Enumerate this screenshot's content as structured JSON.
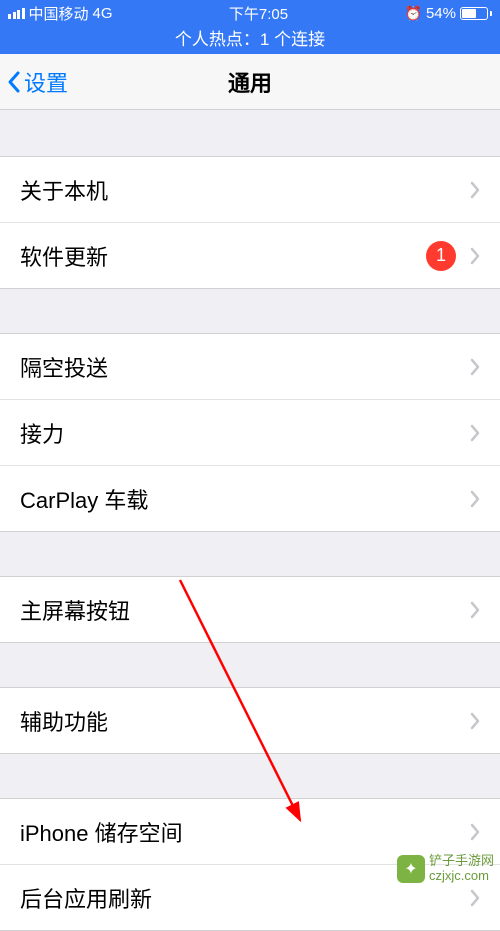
{
  "status": {
    "carrier": "中国移动",
    "network": "4G",
    "time": "下午7:05",
    "battery_pct": "54%"
  },
  "hotspot": "个人热点：1 个连接",
  "nav": {
    "back": "设置",
    "title": "通用"
  },
  "sections": [
    {
      "rows": [
        {
          "label": "关于本机"
        },
        {
          "label": "软件更新",
          "badge": "1"
        }
      ]
    },
    {
      "rows": [
        {
          "label": "隔空投送"
        },
        {
          "label": "接力"
        },
        {
          "label": "CarPlay 车载"
        }
      ]
    },
    {
      "rows": [
        {
          "label": "主屏幕按钮"
        }
      ]
    },
    {
      "rows": [
        {
          "label": "辅助功能"
        }
      ]
    },
    {
      "rows": [
        {
          "label": "iPhone 储存空间"
        },
        {
          "label": "后台应用刷新"
        }
      ]
    }
  ],
  "watermark": {
    "name": "铲子手游网",
    "url": "czjxjc.com"
  }
}
